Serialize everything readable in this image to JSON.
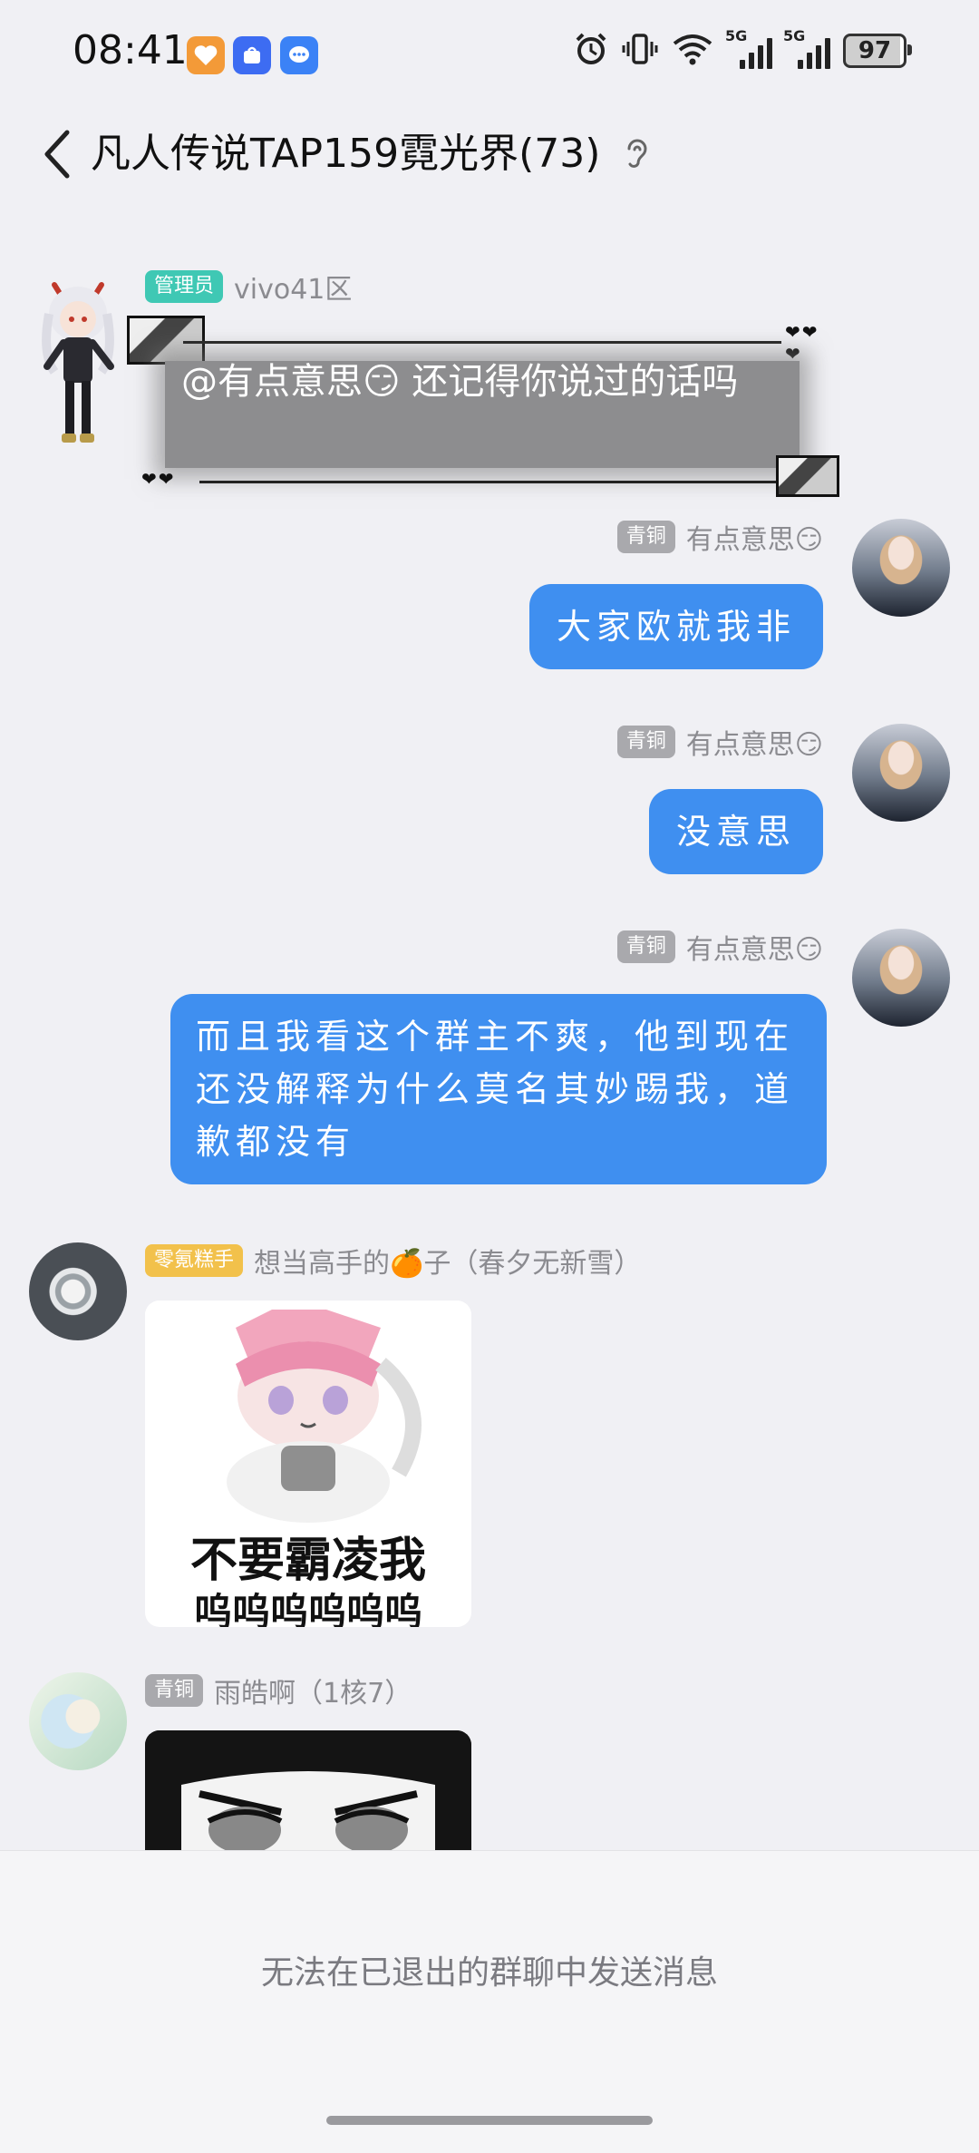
{
  "status_bar": {
    "time": "08:41",
    "battery": "97",
    "signal_tag_1": "5G",
    "signal_tag_2": "5G",
    "icons": [
      "heart-app-icon",
      "app-market-icon",
      "messages-icon",
      "alarm-icon",
      "vibrate-icon",
      "wifi-icon",
      "signal-icon",
      "signal-icon",
      "battery-icon"
    ]
  },
  "header": {
    "title": "凡人传说TAP159霓光界(73)",
    "back_icon": "chevron-left-icon",
    "right_icon": "ear-icon"
  },
  "messages": [
    {
      "side": "left",
      "badge": "管理员",
      "sender": "vivo41区",
      "text": "@有点意思😏 还记得你说过的话吗"
    },
    {
      "side": "right",
      "badge": "青铜",
      "sender": "有点意思😏",
      "text": "大家欧就我非"
    },
    {
      "side": "right",
      "badge": "青铜",
      "sender": "有点意思😏",
      "text": "没意思"
    },
    {
      "side": "right",
      "badge": "青铜",
      "sender": "有点意思😏",
      "text": "而且我看这个群主不爽，他到现在还没解释为什么莫名其妙踢我，道歉都没有"
    },
    {
      "side": "left",
      "badge": "零氪糕手",
      "sender": "想当高手的🍊子（春夕无新雪）",
      "sticker_caption": "不要霸凌我",
      "sticker_sub": "呜呜呜呜呜呜"
    },
    {
      "side": "left",
      "badge": "青铜",
      "sender": "雨皓啊（1核7）"
    }
  ],
  "footer": {
    "notice": "无法在已退出的群聊中发送消息"
  },
  "colors": {
    "bubble_blue": "#3f8ff0",
    "admin_badge": "#3fc8b4",
    "bronze_badge": "#a9a9ad",
    "gold_badge": "#f2c14b",
    "background": "#f0f0f4"
  }
}
